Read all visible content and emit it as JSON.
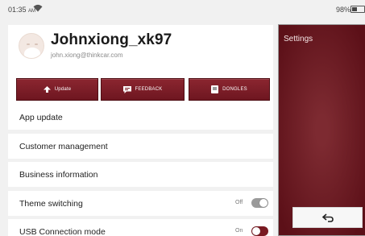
{
  "status_bar": {
    "time": "01:35",
    "ampm": "AM",
    "battery": "98%"
  },
  "profile": {
    "username": "Johnxiong_xk97",
    "email": "john.xiong@thinkcar.com"
  },
  "actions": [
    {
      "label": "Update",
      "icon": "upload-icon"
    },
    {
      "label": "FEEDBACK",
      "icon": "feedback-icon"
    },
    {
      "label": "DONGLES",
      "icon": "dongle-icon"
    }
  ],
  "menu": [
    {
      "label": "App update"
    },
    {
      "label": "Customer management"
    },
    {
      "label": "Business information"
    },
    {
      "label": "Theme switching",
      "state": "Off"
    },
    {
      "label": "USB Connection mode",
      "state": "On"
    }
  ],
  "settings": {
    "title": "Settings",
    "back_icon": "back-arrow-icon"
  },
  "colors": {
    "accent": "#7a1a22",
    "background": "#f1f1f1"
  }
}
